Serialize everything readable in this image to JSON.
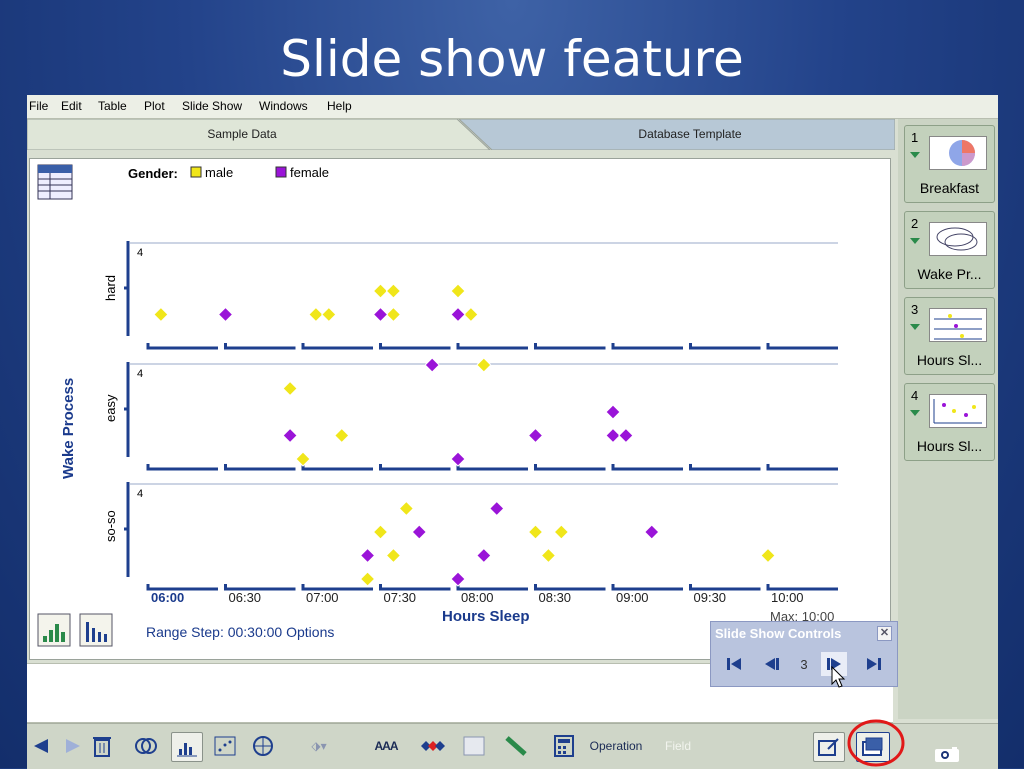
{
  "slide": {
    "title": "Slide show feature"
  },
  "menubar": {
    "items": [
      "File",
      "Edit",
      "Table",
      "Plot",
      "Slide Show",
      "Windows",
      "Help"
    ]
  },
  "tabs": {
    "active": "Sample Data",
    "inactive": "Database Template"
  },
  "legend": {
    "label": "Gender:",
    "entries": [
      {
        "name": "male",
        "color": "#f0e61a"
      },
      {
        "name": "female",
        "color": "#9a14d8"
      }
    ]
  },
  "chart_data": {
    "type": "scatter",
    "xlabel": "Hours Sleep",
    "ylabel": "Wake Process",
    "x_ticks": [
      "06:00",
      "06:30",
      "07:00",
      "07:30",
      "08:00",
      "08:30",
      "09:00",
      "09:30",
      "10:00"
    ],
    "x_max_label": "Max: 10:00",
    "panels": [
      "hard",
      "easy",
      "so-so"
    ],
    "panel_max_label": "4",
    "series": [
      {
        "name": "male",
        "points": [
          {
            "panel": "hard",
            "x": "06:05",
            "y": 1
          },
          {
            "panel": "hard",
            "x": "07:05",
            "y": 1
          },
          {
            "panel": "hard",
            "x": "07:10",
            "y": 1
          },
          {
            "panel": "hard",
            "x": "07:30",
            "y": 2
          },
          {
            "panel": "hard",
            "x": "07:35",
            "y": 1
          },
          {
            "panel": "hard",
            "x": "07:35",
            "y": 2
          },
          {
            "panel": "hard",
            "x": "08:00",
            "y": 2
          },
          {
            "panel": "hard",
            "x": "08:05",
            "y": 1
          },
          {
            "panel": "easy",
            "x": "06:55",
            "y": 3
          },
          {
            "panel": "easy",
            "x": "07:00",
            "y": 0
          },
          {
            "panel": "easy",
            "x": "07:15",
            "y": 1
          },
          {
            "panel": "easy",
            "x": "08:10",
            "y": 4
          },
          {
            "panel": "so-so",
            "x": "07:25",
            "y": 0
          },
          {
            "panel": "so-so",
            "x": "07:30",
            "y": 2
          },
          {
            "panel": "so-so",
            "x": "07:35",
            "y": 1
          },
          {
            "panel": "so-so",
            "x": "07:40",
            "y": 3
          },
          {
            "panel": "so-so",
            "x": "08:30",
            "y": 2
          },
          {
            "panel": "so-so",
            "x": "08:35",
            "y": 1
          },
          {
            "panel": "so-so",
            "x": "08:40",
            "y": 2
          },
          {
            "panel": "so-so",
            "x": "10:00",
            "y": 1
          }
        ]
      },
      {
        "name": "female",
        "points": [
          {
            "panel": "hard",
            "x": "06:30",
            "y": 1
          },
          {
            "panel": "hard",
            "x": "07:30",
            "y": 1
          },
          {
            "panel": "hard",
            "x": "08:00",
            "y": 1
          },
          {
            "panel": "easy",
            "x": "06:55",
            "y": 1
          },
          {
            "panel": "easy",
            "x": "07:50",
            "y": 4
          },
          {
            "panel": "easy",
            "x": "08:00",
            "y": 0
          },
          {
            "panel": "easy",
            "x": "08:30",
            "y": 1
          },
          {
            "panel": "easy",
            "x": "09:00",
            "y": 1
          },
          {
            "panel": "easy",
            "x": "09:00",
            "y": 2
          },
          {
            "panel": "easy",
            "x": "09:05",
            "y": 1
          },
          {
            "panel": "so-so",
            "x": "07:25",
            "y": 1
          },
          {
            "panel": "so-so",
            "x": "07:45",
            "y": 2
          },
          {
            "panel": "so-so",
            "x": "08:00",
            "y": 0
          },
          {
            "panel": "so-so",
            "x": "08:10",
            "y": 1
          },
          {
            "panel": "so-so",
            "x": "08:15",
            "y": 3
          },
          {
            "panel": "so-so",
            "x": "09:15",
            "y": 2
          }
        ]
      }
    ],
    "grid": false
  },
  "range_text": "Range Step: 00:30:00  Options",
  "sidebar": {
    "slides": [
      {
        "num": "1",
        "caption": "Breakfast",
        "icon": "pie-chart-thumbnail"
      },
      {
        "num": "2",
        "caption": "Wake Pr...",
        "icon": "venn-thumbnail"
      },
      {
        "num": "3",
        "caption": "Hours Sl...",
        "icon": "stacked-dot-thumbnail"
      },
      {
        "num": "4",
        "caption": "Hours Sl...",
        "icon": "scatter-thumbnail"
      }
    ]
  },
  "slideshow_controls": {
    "title": "Slide Show Controls",
    "current": "3"
  },
  "toolbar": {
    "operation_label": "Operation",
    "field_label": "Field",
    "text_tool": "AAA"
  }
}
